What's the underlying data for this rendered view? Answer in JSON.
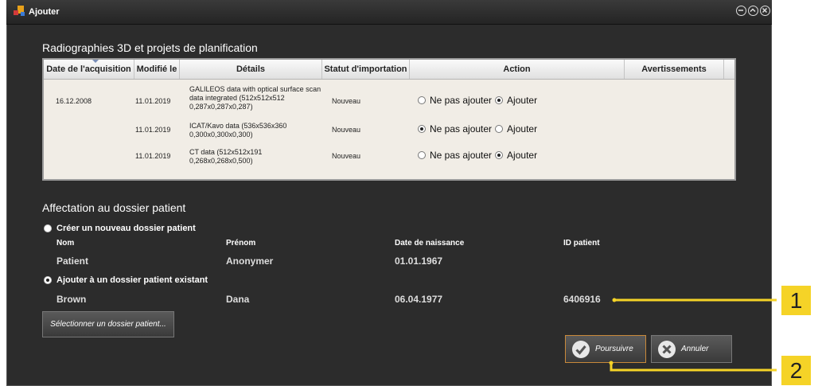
{
  "window": {
    "title": "Ajouter"
  },
  "imports": {
    "title": "Radiographies 3D et projets de planification",
    "columns": [
      "Date de l'acquisition",
      "Modifié le",
      "Détails",
      "Statut d'importation",
      "Action",
      "Avertissements"
    ],
    "rows": [
      {
        "acquired": "16.12.2008",
        "modified": "11.01.2019",
        "details": [
          "GALILEOS data with optical surface scan",
          "data integrated (512x512x512",
          "0,287x0,287x0,287)"
        ],
        "status": "Nouveau",
        "selected": "ajouter"
      },
      {
        "acquired": "",
        "modified": "11.01.2019",
        "details": [
          "ICAT/Kavo data (536x536x360",
          "0,300x0,300x0,300)"
        ],
        "status": "Nouveau",
        "selected": "ne_pas"
      },
      {
        "acquired": "",
        "modified": "11.01.2019",
        "details": [
          "CT data (512x512x191",
          "0,268x0,268x0,500)"
        ],
        "status": "Nouveau",
        "selected": "ajouter"
      }
    ],
    "action_labels": {
      "skip": "Ne pas ajouter",
      "add": "Ajouter"
    }
  },
  "assignment": {
    "title": "Affectation au dossier patient",
    "new_patient": {
      "option_label": "Créer un nouveau dossier patient",
      "headers": {
        "last": "Nom",
        "first": "Prénom",
        "birth": "Date de naissance",
        "id": "ID patient"
      },
      "last": "Patient",
      "first": "Anonymer",
      "birth": "01.01.1967"
    },
    "existing_patient": {
      "option_label": "Ajouter à un dossier patient existant",
      "last": "Brown",
      "first": "Dana",
      "birth": "06.04.1977",
      "id": "6406916"
    },
    "select_button": "Sélectionner un dossier patient...",
    "selected_option": "existing"
  },
  "footer": {
    "continue_label": "Poursuivre",
    "cancel_label": "Annuler"
  },
  "callouts": [
    "1",
    "2"
  ],
  "colors": {
    "callout": "#f5d327",
    "window_bg": "#2c2c2c",
    "table_bg": "#f1ede6"
  }
}
